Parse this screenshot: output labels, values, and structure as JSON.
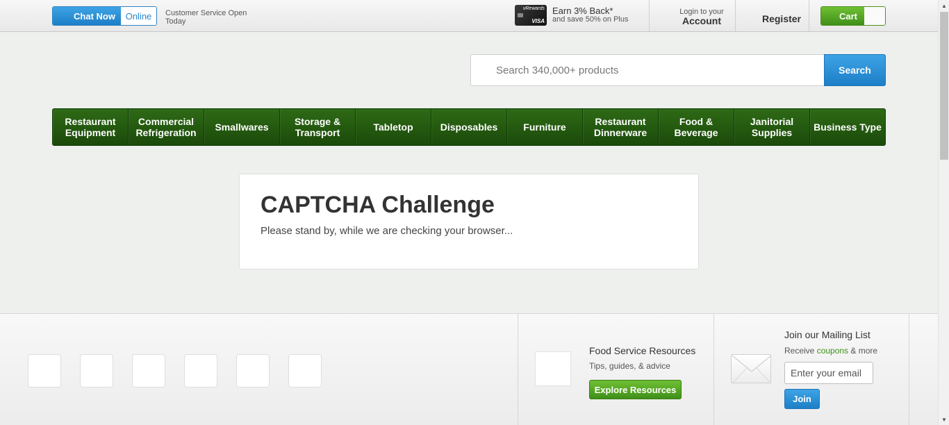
{
  "topbar": {
    "chat_now": "Chat Now",
    "chat_status": "Online",
    "customer_service": "Customer Service Open Today",
    "rewards_card_brand": "vRewards",
    "rewards_card_network": "VISA",
    "rewards_main": "Earn 3% Back*",
    "rewards_sub": "and save 50% on Plus",
    "login_small": "Login to your",
    "login_big": "Account",
    "register": "Register",
    "cart": "Cart"
  },
  "search": {
    "placeholder": "Search 340,000+ products",
    "button": "Search"
  },
  "categories": [
    "Restaurant Equipment",
    "Commercial Refrigeration",
    "Smallwares",
    "Storage & Transport",
    "Tabletop",
    "Disposables",
    "Furniture",
    "Restaurant Dinnerware",
    "Food & Beverage",
    "Janitorial Supplies",
    "Business Type"
  ],
  "captcha": {
    "title": "CAPTCHA Challenge",
    "message": "Please stand by, while we are checking your browser..."
  },
  "footer": {
    "resources_title": "Food Service Resources",
    "resources_sub": "Tips, guides, & advice",
    "resources_button": "Explore Resources",
    "mailing_title": "Join our Mailing List",
    "mailing_sub_before": "Receive ",
    "mailing_sub_link": "coupons",
    "mailing_sub_after": " & more",
    "email_placeholder": "Enter your email",
    "join_button": "Join"
  },
  "colors": {
    "blue_accent": "#1d7fc7",
    "green_accent": "#3f8f1a",
    "nav_green": "#1b4a0a"
  }
}
